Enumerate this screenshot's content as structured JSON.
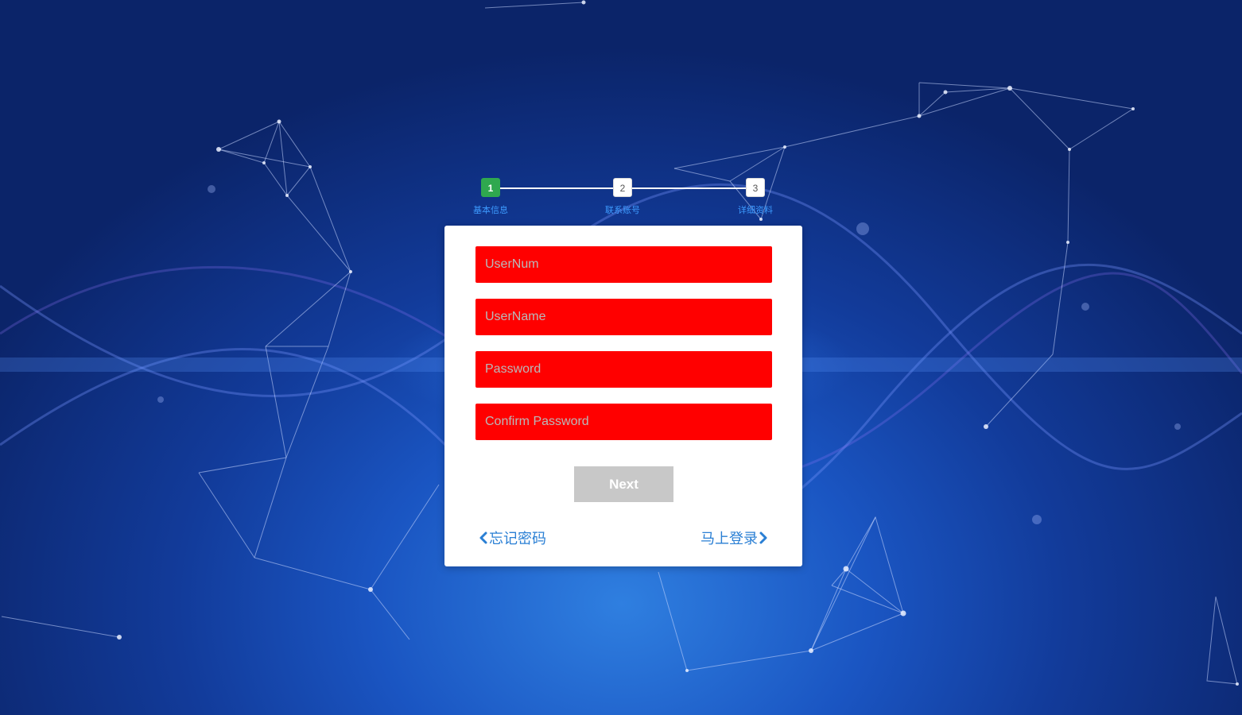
{
  "stepper": {
    "steps": [
      {
        "number": "1",
        "label": "基本信息",
        "active": true
      },
      {
        "number": "2",
        "label": "联系账号",
        "active": false
      },
      {
        "number": "3",
        "label": "详细资料",
        "active": false
      }
    ]
  },
  "form": {
    "usernum_placeholder": "UserNum",
    "username_placeholder": "UserName",
    "password_placeholder": "Password",
    "confirm_password_placeholder": "Confirm Password",
    "next_label": "Next"
  },
  "links": {
    "forgot_password": "忘记密码",
    "login_now": "马上登录"
  },
  "colors": {
    "field_background": "#ff0000",
    "active_step": "#2fa84f",
    "link": "#2a7fd4",
    "next_button": "#c8c8c8"
  },
  "icons": {
    "back": "chevron-left-icon",
    "forward": "chevron-right-icon"
  }
}
